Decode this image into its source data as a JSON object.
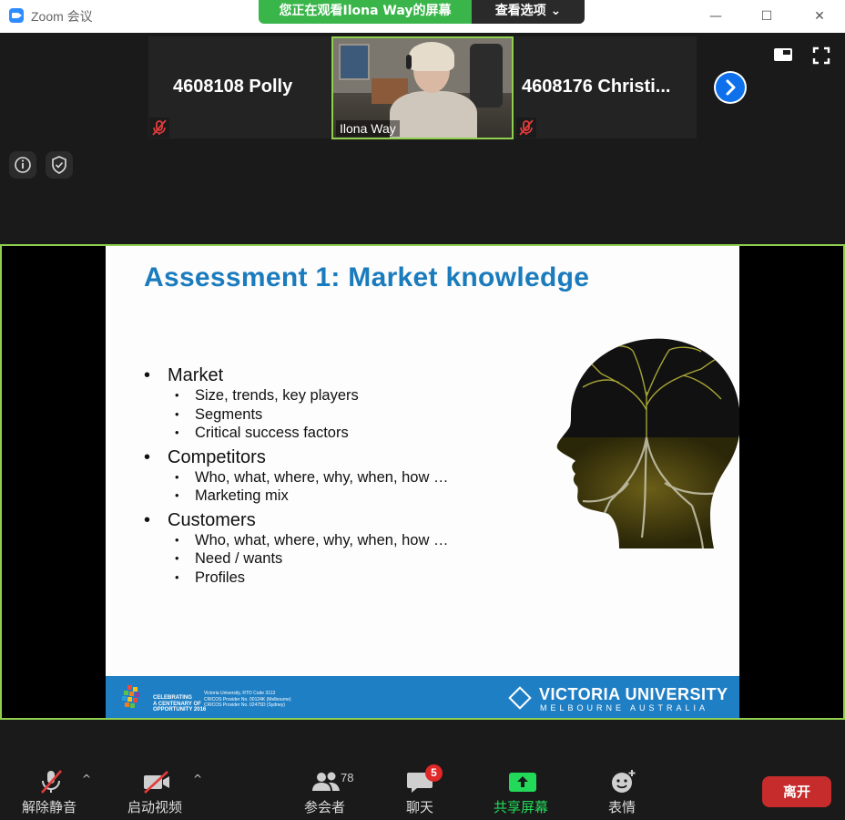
{
  "window": {
    "title": "Zoom 会议",
    "controls": {
      "minimize": "—",
      "maximize": "☐",
      "close": "✕"
    }
  },
  "view_banner": {
    "viewing_text": "您正在观看Ilona Way的屏幕",
    "view_options": "查看选项 ⌄",
    "colors": {
      "viewing_bg": "#39b54a",
      "options_bg": "#2a2a2a"
    }
  },
  "participants_strip": {
    "tiles": [
      {
        "name": "4608108 Polly",
        "muted": true
      },
      {
        "name": "Ilona Way",
        "video": true
      },
      {
        "name": "4608176  Christi...",
        "muted": true
      }
    ],
    "next_icon": "chevron-right-icon"
  },
  "top_right": {
    "layout_icon": "speaker-layout-icon",
    "fullscreen_icon": "fullscreen-icon"
  },
  "meeting_icons": {
    "info_icon": "info-icon",
    "security_icon": "shield-icon"
  },
  "slide": {
    "title": "Assessment 1: Market knowledge",
    "sections": [
      {
        "heading": "Market",
        "items": [
          "Size, trends, key players",
          "Segments",
          "Critical success factors"
        ]
      },
      {
        "heading": "Competitors",
        "items": [
          "Who, what, where, why, when, how …",
          "Marketing mix"
        ]
      },
      {
        "heading": "Customers",
        "items": [
          "Who, what, where, why, when, how …",
          "Need / wants",
          "Profiles"
        ]
      }
    ],
    "footer": {
      "celebrating": "CELEBRATING\nA CENTENARY OF\nOPPORTUNITY 2016",
      "small_lines": [
        "Victoria University, RTO Code 3113",
        "CRICOS Provider No. 00124K (Melbourne)",
        "CRICOS Provider No. 02475D (Sydney)"
      ],
      "university": "VICTORIA UNIVERSITY",
      "location": "MELBOURNE  AUSTRALIA"
    },
    "colors": {
      "title": "#1a7bbd",
      "footer": "#1f7fc4"
    }
  },
  "toolbar": {
    "unmute": "解除静音",
    "start_video": "启动视频",
    "participants": "参会者",
    "participants_count": "78",
    "chat": "聊天",
    "chat_badge": "5",
    "share_screen": "共享屏幕",
    "reactions": "表情",
    "leave": "离开",
    "colors": {
      "share": "#23d959",
      "leave": "#c72c2c"
    }
  }
}
